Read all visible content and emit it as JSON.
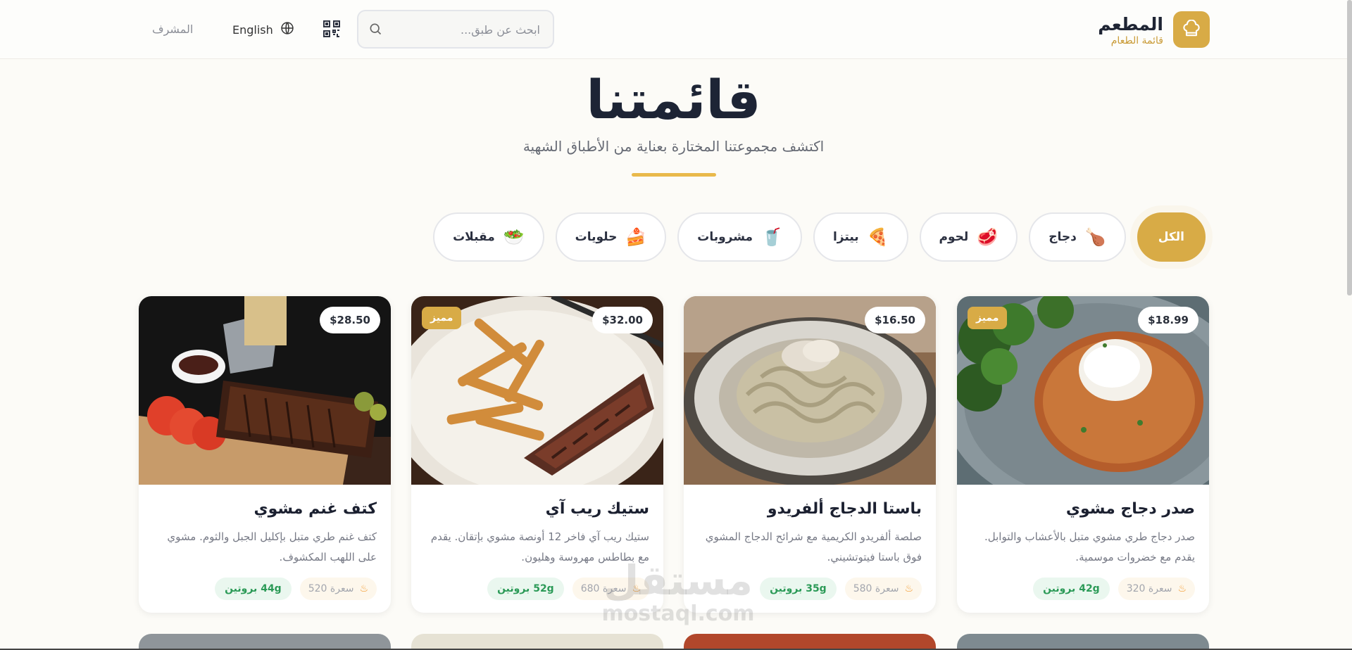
{
  "header": {
    "brand_name": "المطعم",
    "brand_sub": "قائمة الطعام",
    "search_placeholder": "ابحث عن طبق...",
    "language": "English",
    "admin": "المشرف"
  },
  "hero": {
    "title": "قائمتنا",
    "subtitle": "اكتشف مجموعتنا المختارة بعناية من الأطباق الشهية"
  },
  "categories": [
    {
      "label": "الكل",
      "icon": "",
      "active": true
    },
    {
      "label": "دجاج",
      "icon": "🍗",
      "active": false
    },
    {
      "label": "لحوم",
      "icon": "🥩",
      "active": false
    },
    {
      "label": "بيتزا",
      "icon": "🍕",
      "active": false
    },
    {
      "label": "مشروبات",
      "icon": "🥤",
      "active": false
    },
    {
      "label": "حلويات",
      "icon": "🍰",
      "active": false
    },
    {
      "label": "مقبلات",
      "icon": "🥗",
      "active": false
    }
  ],
  "dishes": [
    {
      "name": "صدر دجاج مشوي",
      "price": "$18.99",
      "featured": "مميز",
      "desc": "صدر دجاج طري مشوي متبل بالأعشاب والتوابل. يقدم مع خضروات موسمية.",
      "calories": "320 سعرة",
      "protein": "42g بروتين"
    },
    {
      "name": "باستا الدجاج ألفريدو",
      "price": "$16.50",
      "featured": "",
      "desc": "صلصة ألفريدو الكريمية مع شرائح الدجاج المشوي فوق باستا فيتوتشيني.",
      "calories": "580 سعرة",
      "protein": "35g بروتين"
    },
    {
      "name": "ستيك ريب آي",
      "price": "$32.00",
      "featured": "مميز",
      "desc": "ستيك ريب آي فاخر 12 أونصة مشوي بإتقان. يقدم مع بطاطس مهروسة وهليون.",
      "calories": "680 سعرة",
      "protein": "52g بروتين"
    },
    {
      "name": "كتف غنم مشوي",
      "price": "$28.50",
      "featured": "",
      "desc": "كتف غنم طري متبل بإكليل الجبل والثوم. مشوي على اللهب المكشوف.",
      "calories": "520 سعرة",
      "protein": "44g بروتين"
    }
  ],
  "watermark": {
    "line1": "مستقل",
    "line2": "mostaql.com"
  },
  "colors": {
    "accent": "#d8ab46",
    "underline": "#e9b94b",
    "protein_text": "#2b9a57"
  },
  "icons": [
    "chef-hat-icon",
    "search-icon",
    "qr-code-icon",
    "globe-icon",
    "fire-icon"
  ]
}
